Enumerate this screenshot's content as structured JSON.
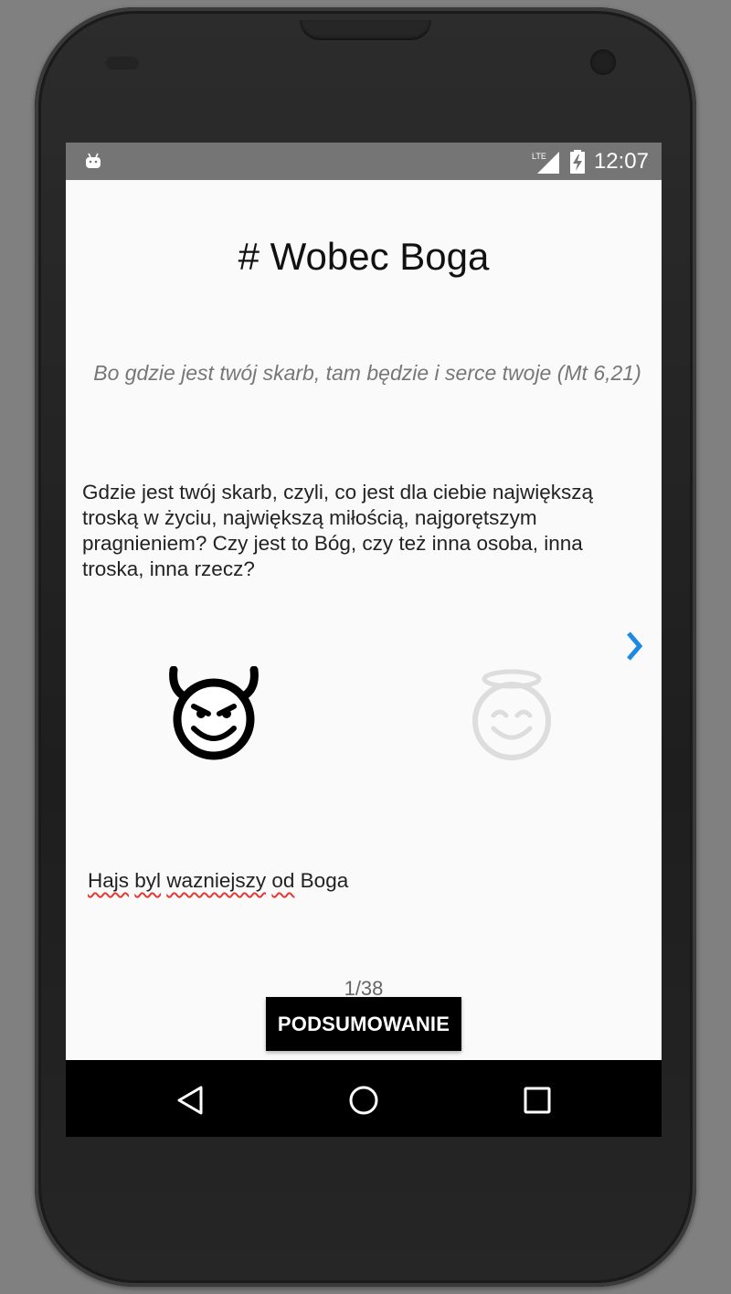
{
  "status_bar": {
    "network_label": "LTE",
    "time": "12:07"
  },
  "main": {
    "title": "# Wobec Boga",
    "quote": "Bo gdzie jest twój skarb, tam będzie i serce twoje (Mt 6,21)",
    "question": "Gdzie jest twój skarb, czyli, co jest dla ciebie największą troską w życiu, największą miłością, najgorętszym pragnieniem? Czy jest to Bóg, czy też inna osoba, inna troska, inna rzecz?",
    "answer_words": [
      "Hajs",
      "byl",
      "wazniejszy",
      "od",
      "Boga"
    ],
    "counter": "1/38",
    "summary_button": "PODSUMOWANIE"
  },
  "icons": {
    "next": "chevron-right-icon",
    "devil": "smiling-devil-icon",
    "angel": "smiling-angel-icon",
    "back": "back-triangle-icon",
    "home": "home-circle-icon",
    "recents": "recents-square-icon"
  },
  "colors": {
    "accent": "#1e88e5",
    "status_bar": "#757575",
    "angel_inactive": "#dddddd",
    "spell_underline": "#e53935"
  }
}
